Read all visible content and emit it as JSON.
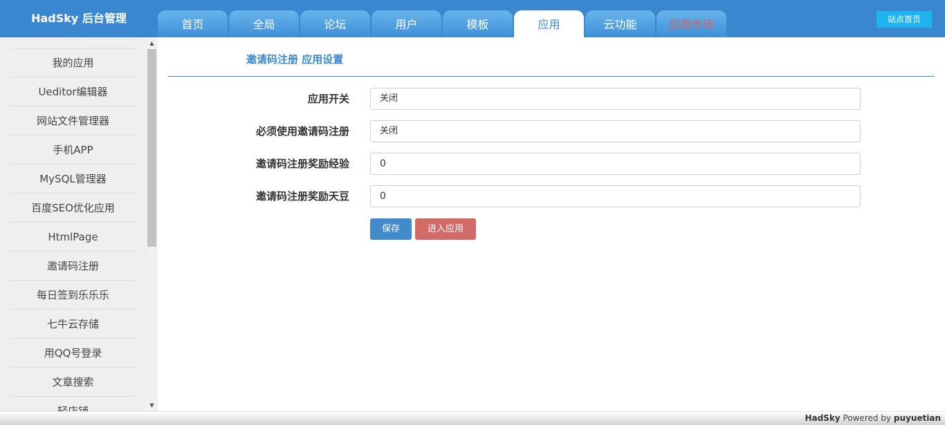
{
  "brand": "HadSky 后台管理",
  "nav": {
    "tabs": [
      "首页",
      "全局",
      "论坛",
      "用户",
      "模板",
      "应用",
      "云功能",
      "应用市场"
    ],
    "active_tab": "应用",
    "site_home": "站点首页"
  },
  "sidebar": {
    "items": [
      {
        "label": "我的应用"
      },
      {
        "label": "Ueditor编辑器"
      },
      {
        "label": "网站文件管理器"
      },
      {
        "label": "手机APP"
      },
      {
        "label": "MySQL管理器"
      },
      {
        "label": "百度SEO优化应用"
      },
      {
        "label": "HtmlPage"
      },
      {
        "label": "邀请码注册"
      },
      {
        "label": "每日签到乐乐乐"
      },
      {
        "label": "七牛云存储"
      },
      {
        "label": "用QQ号登录"
      },
      {
        "label": "文章搜索"
      },
      {
        "label": "轻店铺"
      }
    ]
  },
  "main": {
    "title": "邀请码注册 应用设置",
    "fields": [
      {
        "label": "应用开关",
        "value": "关闭"
      },
      {
        "label": "必须使用邀请码注册",
        "value": "关闭"
      },
      {
        "label": "邀请码注册奖励经验",
        "value": "0"
      },
      {
        "label": "邀请码注册奖励天豆",
        "value": "0"
      }
    ],
    "save_button": "保存",
    "enter_button": "进入应用"
  },
  "footer": {
    "brand": "HadSky",
    "powered_by": "Powered by",
    "author": "puyuetian"
  },
  "colors": {
    "header_blue": "#3b87cf",
    "site_home": "#1fb3ef",
    "save_button": "#428bca",
    "enter_button": "#d26a67",
    "market_tab_text": "#d9625d"
  }
}
